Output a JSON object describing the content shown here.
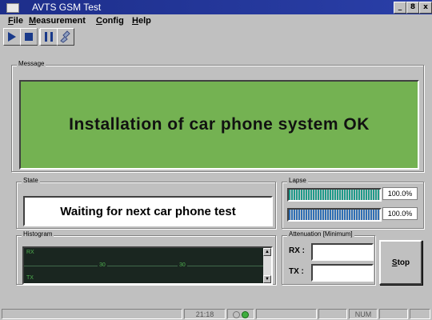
{
  "window": {
    "title": "AVTS  GSM Test",
    "controls": [
      "_",
      "8",
      "x"
    ]
  },
  "menu": [
    {
      "mnemonic": "F",
      "rest": "ile"
    },
    {
      "mnemonic": "M",
      "rest": "easurement"
    },
    {
      "mnemonic": "C",
      "rest": "onfig"
    },
    {
      "mnemonic": "H",
      "rest": "elp"
    }
  ],
  "toolbar": {
    "icons": [
      "play-icon",
      "stop-icon",
      "pause-icon",
      "hand-icon"
    ]
  },
  "message": {
    "group_label": "Message",
    "text": "Installation of car phone system OK",
    "panel_color": "#74b252"
  },
  "state": {
    "group_label": "State",
    "text": "Waiting for next car phone test"
  },
  "lapse": {
    "group_label": "Lapse",
    "bars": [
      {
        "percent_text": "100.0%",
        "fill": 1.0,
        "color": "#1f9a8a"
      },
      {
        "percent_text": "100.0%",
        "fill": 1.0,
        "color": "#2f6fb4"
      }
    ]
  },
  "histogram": {
    "group_label": "Histogram",
    "rx_label": "RX",
    "tx_label": "TX",
    "tick_1": "30",
    "tick_2": "30"
  },
  "attenuation": {
    "group_label": "Attenuation [Minimum]",
    "rx_label": "RX :",
    "tx_label": "TX :",
    "rx_value": "",
    "tx_value": ""
  },
  "stop_button": {
    "mnemonic": "S",
    "rest": "top"
  },
  "statusbar": {
    "time": "21:18",
    "num": "NUM"
  }
}
